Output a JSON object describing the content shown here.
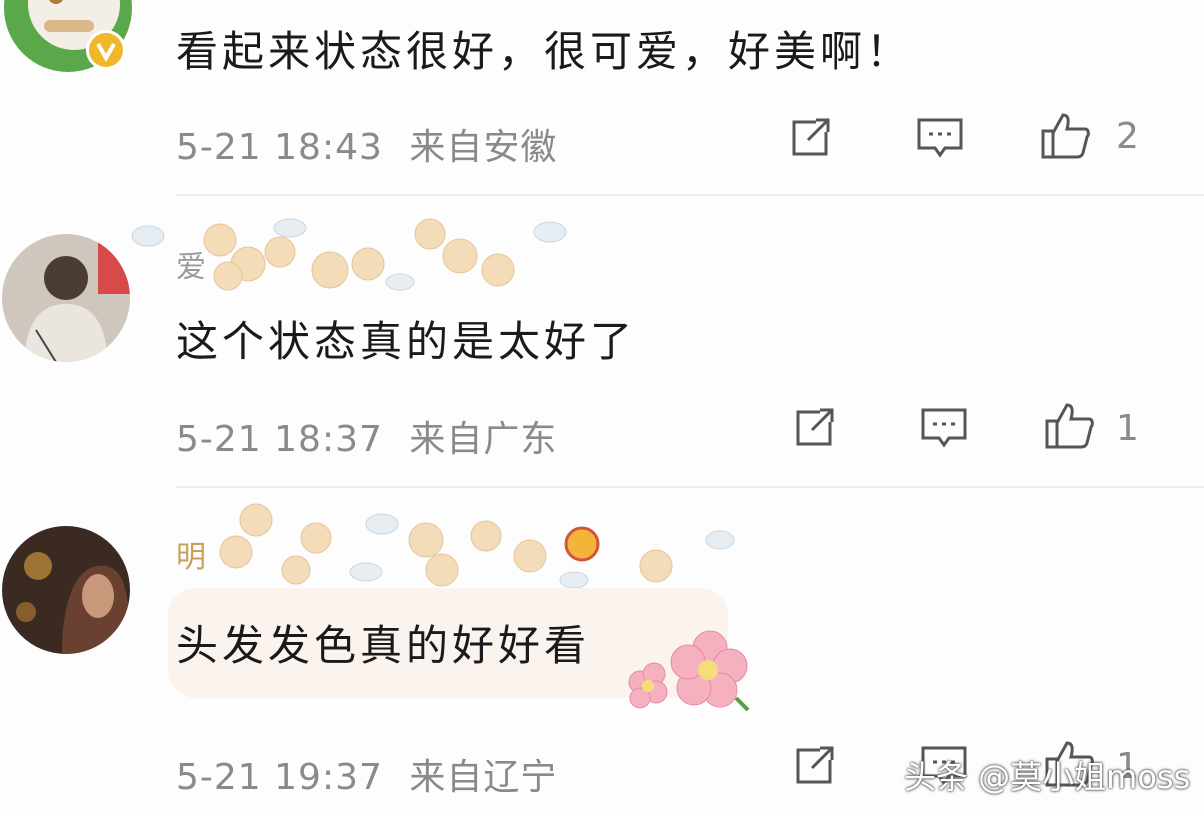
{
  "comments": [
    {
      "text": "看起来状态很好，很可爱，好美啊！",
      "time": "5-21 18:43",
      "location": "来自安徽",
      "likes": "2"
    },
    {
      "username": "爱",
      "text": "这个状态真的是太好了",
      "time": "5-21 18:37",
      "location": "来自广东",
      "likes": "1"
    },
    {
      "username": "明",
      "text": "头发发色真的好好看",
      "time": "5-21 19:37",
      "location": "来自辽宁",
      "likes": "1"
    }
  ],
  "watermark": "头条 @莫小姐moss",
  "icons": {
    "share": "share-icon",
    "reply": "comment-icon",
    "like": "thumbs-up-icon",
    "verified": "verified-badge-icon"
  },
  "colors": {
    "text": "#1a1a1a",
    "meta": "#8a8a8a",
    "username": "#c7a05a",
    "badge": "#f0b72a"
  }
}
